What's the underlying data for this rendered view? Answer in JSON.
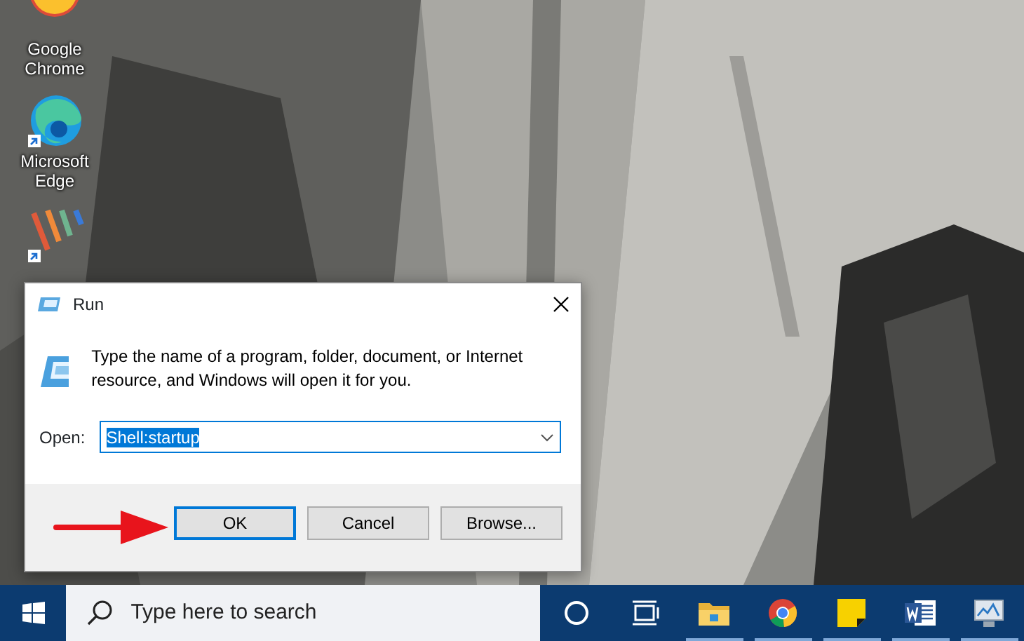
{
  "desktop_icons": [
    {
      "kind": "chrome",
      "label": "Google Chrome"
    },
    {
      "kind": "edge",
      "label": "Microsoft Edge"
    },
    {
      "kind": "picpick"
    }
  ],
  "run_dialog": {
    "title": "Run",
    "prompt": "Type the name of a program, folder, document, or Internet resource, and Windows will open it for you.",
    "open_label": "Open:",
    "value": "Shell:startup",
    "value_selected": true,
    "buttons": [
      {
        "label": "OK",
        "default": true
      },
      {
        "label": "Cancel",
        "default": false
      },
      {
        "label": "Browse...",
        "default": false
      }
    ]
  },
  "taskbar": {
    "search": {
      "placeholder": "Type here to search"
    },
    "apps": [
      {
        "kind": "cortana",
        "running": false
      },
      {
        "kind": "taskview",
        "running": false
      },
      {
        "kind": "explorer",
        "running": true
      },
      {
        "kind": "chrome",
        "running": true
      },
      {
        "kind": "sticky",
        "running": true
      },
      {
        "kind": "word",
        "running": true
      },
      {
        "kind": "monitor",
        "running": true
      }
    ]
  }
}
